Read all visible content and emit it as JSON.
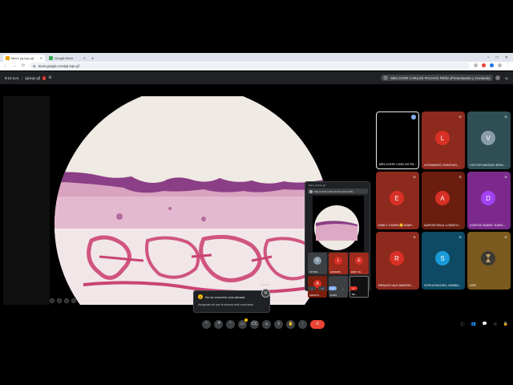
{
  "browser": {
    "tabs": [
      {
        "title": "Meet: pij-kqv-yjf",
        "active": true
      },
      {
        "title": "Google Meet",
        "active": false
      }
    ],
    "new_tab": "+",
    "url": "meet.google.com/pij-kqv-yjf",
    "controls": {
      "minimize": "–",
      "maximize": "□",
      "close": "✕"
    }
  },
  "meet": {
    "time": "9:12 a.m.",
    "meeting_code": "pij-kqv-yjf",
    "recording_badge": "1",
    "presenter_label": "MELCHOR CARLOS PACHAS PEÑA (Presentando y enviando)",
    "participant_count": "11"
  },
  "pip": {
    "title": "Meet: pij-kqv-yjf",
    "presenter_bar": "MELCHOR CARLOS PACHAS PEÑ...",
    "tiles": [
      {
        "initial": "V",
        "name": "VICTOR...",
        "style": "grey"
      },
      {
        "initial": "L",
        "name": "LEONARD...",
        "style": "red"
      },
      {
        "initial": "E",
        "name": "EMILY CH...",
        "style": "red"
      },
      {
        "initial": "A",
        "name": "AARON R...",
        "style": "brown"
      },
      {
        "initial": "",
        "name": "B-NSS",
        "style": "plain"
      },
      {
        "initial": "",
        "name": "ME...",
        "style": "dark"
      }
    ]
  },
  "toast": {
    "tooltip": "Cerrar",
    "close_icon": "✕",
    "title": "No se encontró una cámara",
    "body": "Asegúrate de que la cámara esté conectada"
  },
  "participants": [
    {
      "name": "MELCHOR CARLOS PA...",
      "initial": "",
      "color": "#000000",
      "mic_active": true,
      "selected": true
    },
    {
      "name": "LEONARDO SANTIAG...",
      "initial": "L",
      "color": "#8d2a1e",
      "avatar": "#d93025",
      "mic_active": false
    },
    {
      "name": "VICTOR MATIAS JESU...",
      "initial": "V",
      "color": "#2f4f55",
      "avatar": "#8a9ba8",
      "mic_active": false
    },
    {
      "name": "EMILY CHARL🙂ZNAP...",
      "initial": "E",
      "color": "#8d2a1e",
      "avatar": "#d93025",
      "mic_active": false
    },
    {
      "name": "AARON RAUL LOBATO...",
      "initial": "A",
      "color": "#6b1d10",
      "avatar": "#d93025",
      "mic_active": false
    },
    {
      "name": "DORITA ISABEL SANC...",
      "initial": "D",
      "color": "#7b2a8c",
      "avatar": "#a142f4",
      "mic_active": false
    },
    {
      "name": "RENATO ALEJANDRO ...",
      "initial": "R",
      "color": "#8d2a1e",
      "avatar": "#d93025",
      "mic_active": false
    },
    {
      "name": "SOFIA RACHEL GIMEN...",
      "initial": "S",
      "color": "#0e4a63",
      "avatar": "#1a9bd7",
      "mic_active": false
    },
    {
      "name": "NSS",
      "initial": "",
      "color": "#7a5a1e",
      "logo": true,
      "mic_active": false
    }
  ],
  "toolbar": {
    "mic_icon": "🎤",
    "camera_icon": "▭",
    "captions_icon": "CC",
    "emoji_icon": "☺",
    "present_icon": "⇪",
    "hand_icon": "✋",
    "more_icon": "⋮",
    "hangup_icon": "✆",
    "right_icons": [
      "ⓘ",
      "👥",
      "💬",
      "◇",
      "🔒"
    ]
  }
}
